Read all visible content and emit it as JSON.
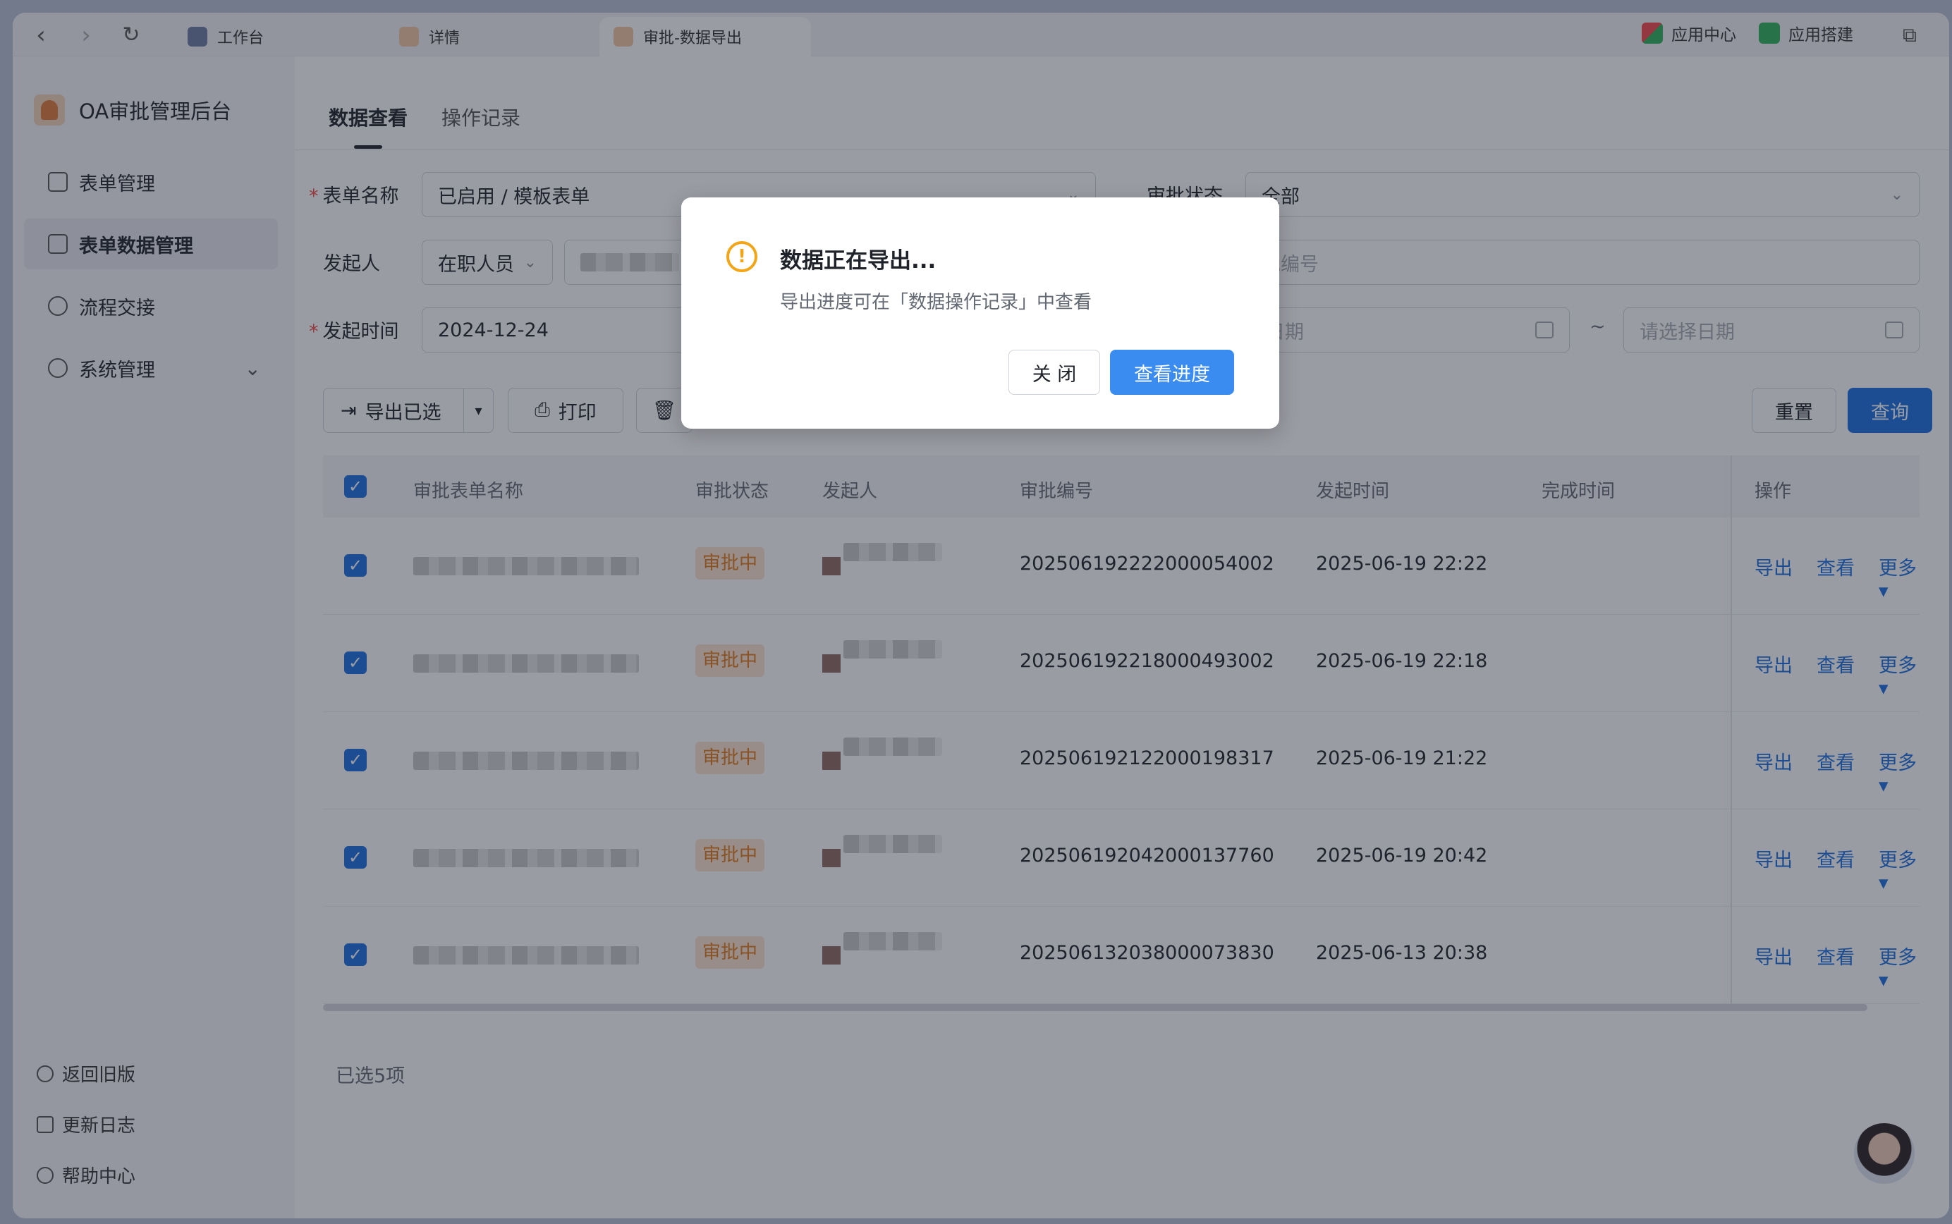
{
  "browser": {
    "tabs": [
      {
        "label": "工作台"
      },
      {
        "label": "详情"
      },
      {
        "label": "审批-数据导出"
      }
    ],
    "right": {
      "app_center": "应用中心",
      "app_build": "应用搭建"
    }
  },
  "sidebar": {
    "brand": "OA审批管理后台",
    "items": [
      {
        "label": "表单管理"
      },
      {
        "label": "表单数据管理"
      },
      {
        "label": "流程交接"
      },
      {
        "label": "系统管理"
      }
    ],
    "footer": [
      {
        "label": "返回旧版"
      },
      {
        "label": "更新日志"
      },
      {
        "label": "帮助中心"
      }
    ]
  },
  "main": {
    "tabs": [
      {
        "label": "数据查看"
      },
      {
        "label": "操作记录"
      }
    ],
    "filters": {
      "form_name_label": "表单名称",
      "form_name_value": "已启用 / 模板表单",
      "approval_status_label": "审批状态",
      "approval_status_value": "全部",
      "initiator_label": "发起人",
      "initiator_type": "在职人员",
      "approval_no_placeholder": "批编号",
      "start_time_label": "发起时间",
      "start_time_value": "2024-12-24",
      "date_placeholder_1": "选择日期",
      "date_sep": "~",
      "date_placeholder_2": "请选择日期"
    },
    "toolbar": {
      "export_selected": "导出已选",
      "print": "打印",
      "reset": "重置",
      "query": "查询"
    },
    "table": {
      "headers": {
        "name": "审批表单名称",
        "status": "审批状态",
        "initiator": "发起人",
        "number": "审批编号",
        "start_time": "发起时间",
        "finish_time": "完成时间",
        "ops": "操作"
      },
      "rows": [
        {
          "status": "审批中",
          "number": "20250619222200005400​2",
          "start_time": "2025-06-19 22:22"
        },
        {
          "status": "审批中",
          "number": "202506192218000493002",
          "start_time": "2025-06-19 22:18"
        },
        {
          "status": "审批中",
          "number": "202506192122000198317",
          "start_time": "2025-06-19 21:22"
        },
        {
          "status": "审批中",
          "number": "202506192042000137760",
          "start_time": "2025-06-19 20:42"
        },
        {
          "status": "审批中",
          "number": "202506132038000073830",
          "start_time": "2025-06-13 20:38"
        }
      ],
      "ops": {
        "export": "导出",
        "view": "查看",
        "more": "更多"
      }
    },
    "selected_count": "已选5项"
  },
  "dialog": {
    "title": "数据正在导出...",
    "description": "导出进度可在「数据操作记录」中查看",
    "close": "关 闭",
    "view_progress": "查看进度"
  },
  "colors": {
    "primary": "#1b6fe0",
    "warning": "#f2a516",
    "status_tag": "#e07a1a"
  }
}
